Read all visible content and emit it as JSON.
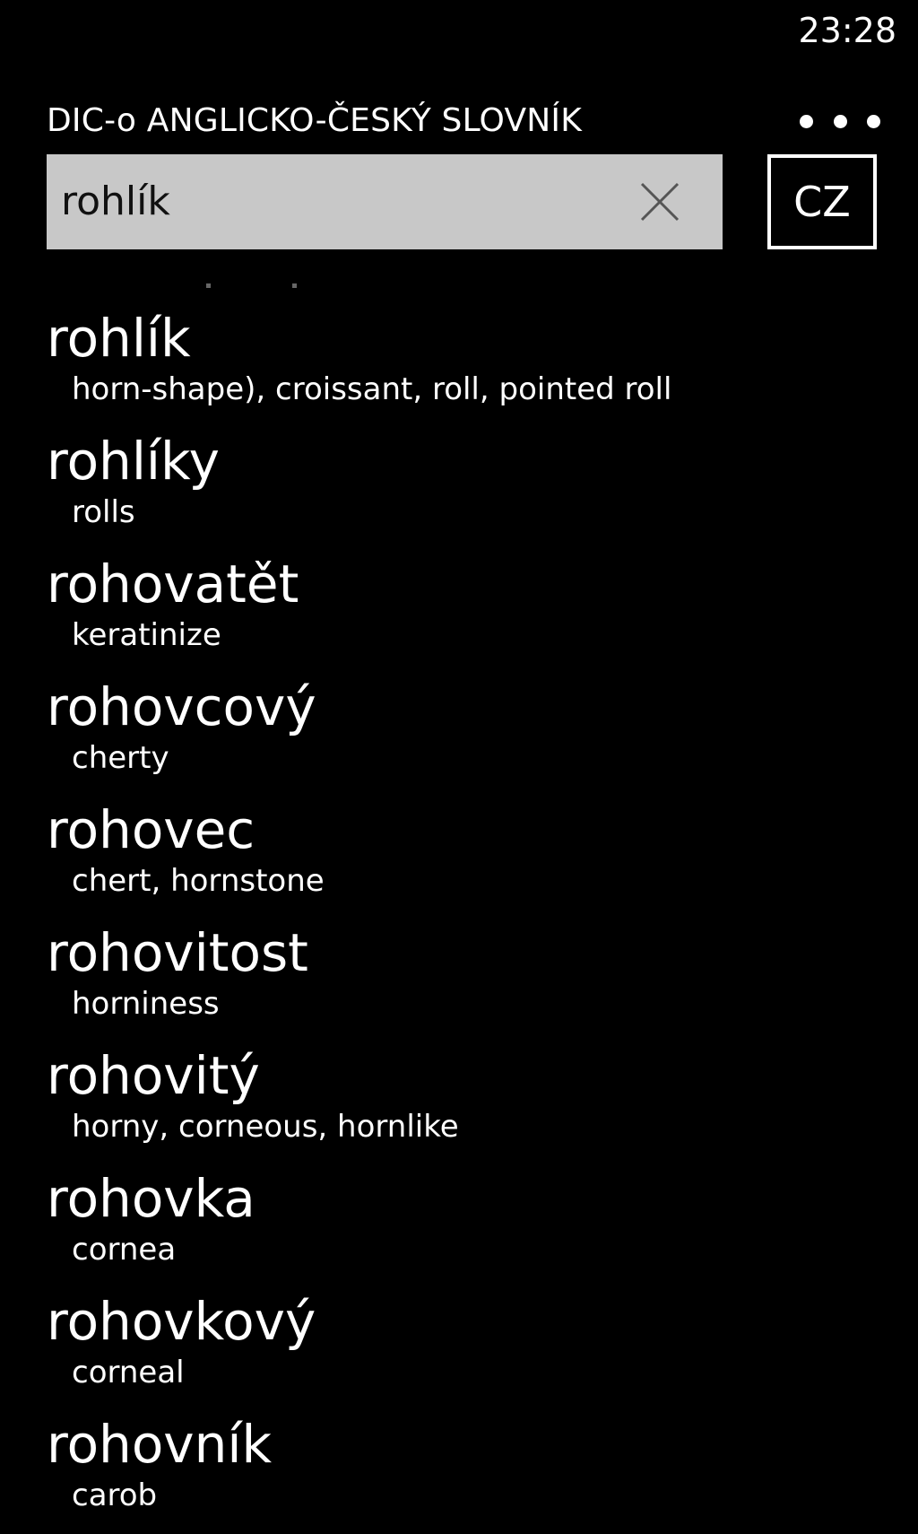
{
  "status_bar": {
    "time": "23:28"
  },
  "app": {
    "title": "DIC-o ANGLICKO-ČESKÝ SLOVNÍK",
    "more_icon": "ellipsis-icon"
  },
  "search": {
    "value": "rohlík",
    "clear_icon": "close-icon",
    "language_label": "CZ"
  },
  "colors": {
    "background": "#000000",
    "text": "#ffffff",
    "search_box": "#c8c8c8",
    "search_text": "#111111"
  },
  "results": [
    {
      "word": "rohlík",
      "translation": "horn-shape), croissant, roll, pointed roll"
    },
    {
      "word": "rohlíky",
      "translation": "rolls"
    },
    {
      "word": "rohovatět",
      "translation": "keratinize"
    },
    {
      "word": "rohovcový",
      "translation": "cherty"
    },
    {
      "word": "rohovec",
      "translation": "chert, hornstone"
    },
    {
      "word": "rohovitost",
      "translation": "horniness"
    },
    {
      "word": "rohovitý",
      "translation": "horny, corneous, hornlike"
    },
    {
      "word": "rohovka",
      "translation": "cornea"
    },
    {
      "word": "rohovkový",
      "translation": "corneal"
    },
    {
      "word": "rohovník",
      "translation": "carob"
    }
  ]
}
